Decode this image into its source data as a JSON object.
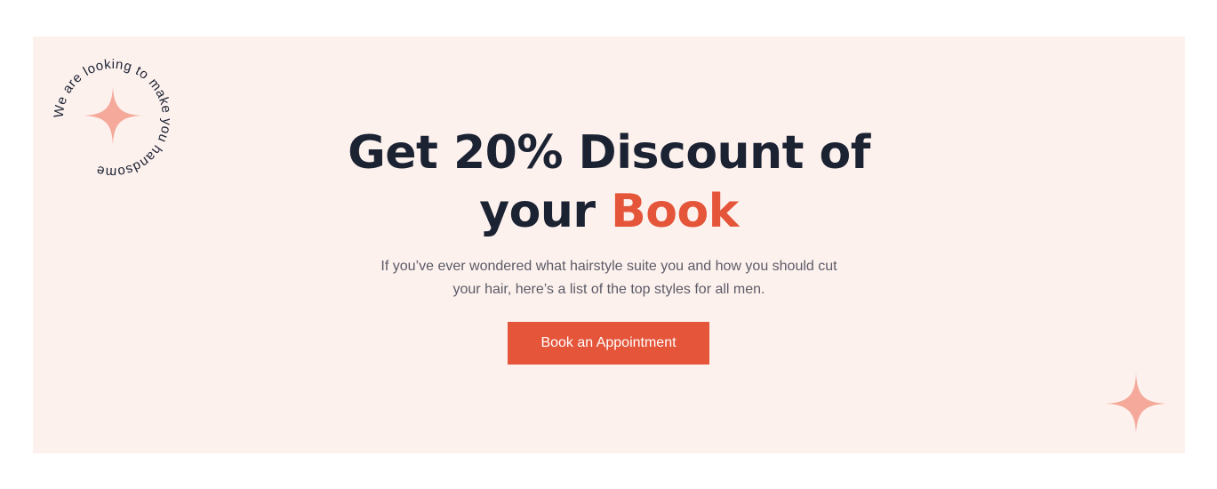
{
  "badge": {
    "circular_text": "We are looking to make you handsome"
  },
  "hero": {
    "headline_line1": "Get 20% Discount of",
    "headline_line2_prefix": "your ",
    "headline_accent": "Book",
    "description_line1": "If you’ve ever wondered what hairstyle suite you and how you should cut",
    "description_line2": "your hair, here’s a list of the top styles for all men.",
    "cta_label": "Book an Appointment"
  },
  "colors": {
    "banner_background": "#fdf1ee",
    "accent": "#e4553a",
    "headline": "#1b2232",
    "body_text": "#5b5b66",
    "star": "#f4a99a"
  },
  "icons": {
    "badge_star": "sparkle-star-icon",
    "corner_star": "sparkle-star-icon"
  }
}
